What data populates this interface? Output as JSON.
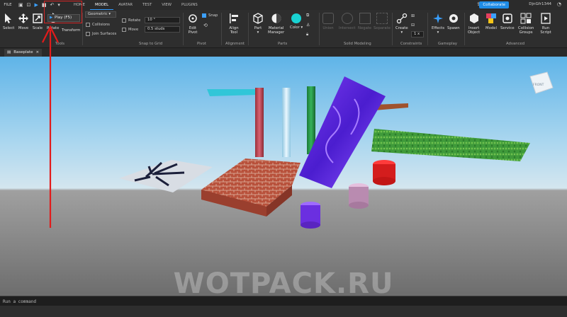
{
  "menu": {
    "file": "FILE",
    "tabs": [
      "HOME",
      "MODEL",
      "AVATAR",
      "TEST",
      "VIEW",
      "PLUGINS"
    ],
    "active_tab": "MODEL",
    "collaborate": "Collaborate",
    "username": "DjnGfr1344"
  },
  "quick_access": {
    "play_icon": "play-icon",
    "stop_icon": "stop-icon",
    "undo_icon": "undo-icon",
    "tooltip": "Play (F5)"
  },
  "tools": {
    "select": "Select",
    "move": "Move",
    "scale": "Scale",
    "rotate": "Rotate",
    "transform": "Transform",
    "group": "Tools"
  },
  "snap": {
    "mode": "Geometric",
    "collisions": "Collisions",
    "join_surfaces": "Join Surfaces",
    "rotate_label": "Rotate",
    "rotate_value": "10 °",
    "move_label": "Move",
    "move_value": "0.5 studs",
    "group": "Snap to Grid"
  },
  "pivot": {
    "edit": "Edit",
    "edit2": "Pivot",
    "snap": "Snap",
    "group": "Pivot"
  },
  "alignment": {
    "align": "Align",
    "align2": "Tool",
    "group": "Alignment"
  },
  "parts": {
    "part": "Part",
    "material": "Material",
    "material2": "Manager",
    "color": "Color",
    "group": "Parts",
    "color_hex": "#19d3d3"
  },
  "solid": {
    "union": "Union",
    "intersect": "Intersect",
    "negate": "Negate",
    "separate": "Separate",
    "group": "Solid Modeling"
  },
  "constraints": {
    "create": "Create",
    "group": "Constraints",
    "scale_value": "1 x"
  },
  "gameplay": {
    "effects": "Effects",
    "spawn": "Spawn",
    "group": "Gameplay"
  },
  "advanced": {
    "insert": "Insert",
    "insert2": "Object",
    "model": "Model",
    "service": "Service",
    "collision": "Collision",
    "collision2": "Groups",
    "run": "Run",
    "run2": "Script",
    "group": "Advanced"
  },
  "document": {
    "tab": "Baseplate",
    "close": "×"
  },
  "viewport": {
    "view_cube_label": "FRONT",
    "watermark": "WOTPACK.RU"
  },
  "command": {
    "placeholder": "Run a command"
  },
  "annotation": {
    "color": "#e21b1b"
  }
}
